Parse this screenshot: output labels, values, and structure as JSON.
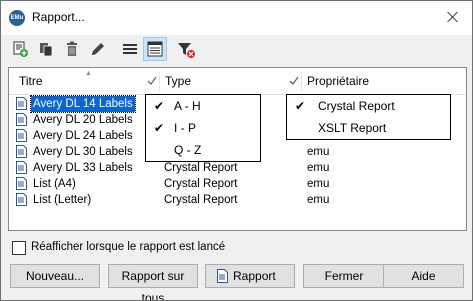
{
  "window": {
    "title": "Rapport...",
    "app_icon_text": "EMu"
  },
  "toolbar": {
    "buttons": [
      {
        "icon": "add-report-icon"
      },
      {
        "icon": "copy-report-icon"
      },
      {
        "icon": "delete-icon"
      },
      {
        "icon": "edit-pencil-icon"
      },
      {
        "icon": "list-view-icon"
      },
      {
        "icon": "details-view-icon",
        "active": true
      },
      {
        "icon": "clear-filter-icon"
      }
    ]
  },
  "list": {
    "columns": {
      "titre": "Titre",
      "type": "Type",
      "proprietaire": "Propriétaire"
    },
    "rows": [
      {
        "titre": "Avery DL 14 Labels",
        "type": "",
        "proprietaire": "",
        "selected": true
      },
      {
        "titre": "Avery DL 20 Labels",
        "type": "",
        "proprietaire": ""
      },
      {
        "titre": "Avery DL 24 Labels",
        "type": "",
        "proprietaire": ""
      },
      {
        "titre": "Avery DL 30 Labels",
        "type": "",
        "proprietaire": "emu"
      },
      {
        "titre": "Avery DL 33 Labels",
        "type": "Crystal Report",
        "proprietaire": "emu"
      },
      {
        "titre": "List (A4)",
        "type": "Crystal Report",
        "proprietaire": "emu"
      },
      {
        "titre": "List (Letter)",
        "type": "Crystal Report",
        "proprietaire": "emu"
      }
    ]
  },
  "type_filter_popup": {
    "items": [
      {
        "label": "A - H",
        "checked": true
      },
      {
        "label": "I - P",
        "checked": true
      },
      {
        "label": "Q - Z",
        "checked": false
      }
    ]
  },
  "owner_filter_popup": {
    "items": [
      {
        "label": "Crystal Report",
        "checked": true
      },
      {
        "label": "XSLT Report",
        "checked": false
      }
    ]
  },
  "options": {
    "reshow_label": "Réafficher lorsque le rapport est lancé",
    "reshow_checked": false
  },
  "buttons": {
    "nouveau": "Nouveau...",
    "rapport_sur_tous": "Rapport sur tous",
    "rapport": "Rapport",
    "fermer": "Fermer",
    "aide": "Aide"
  }
}
